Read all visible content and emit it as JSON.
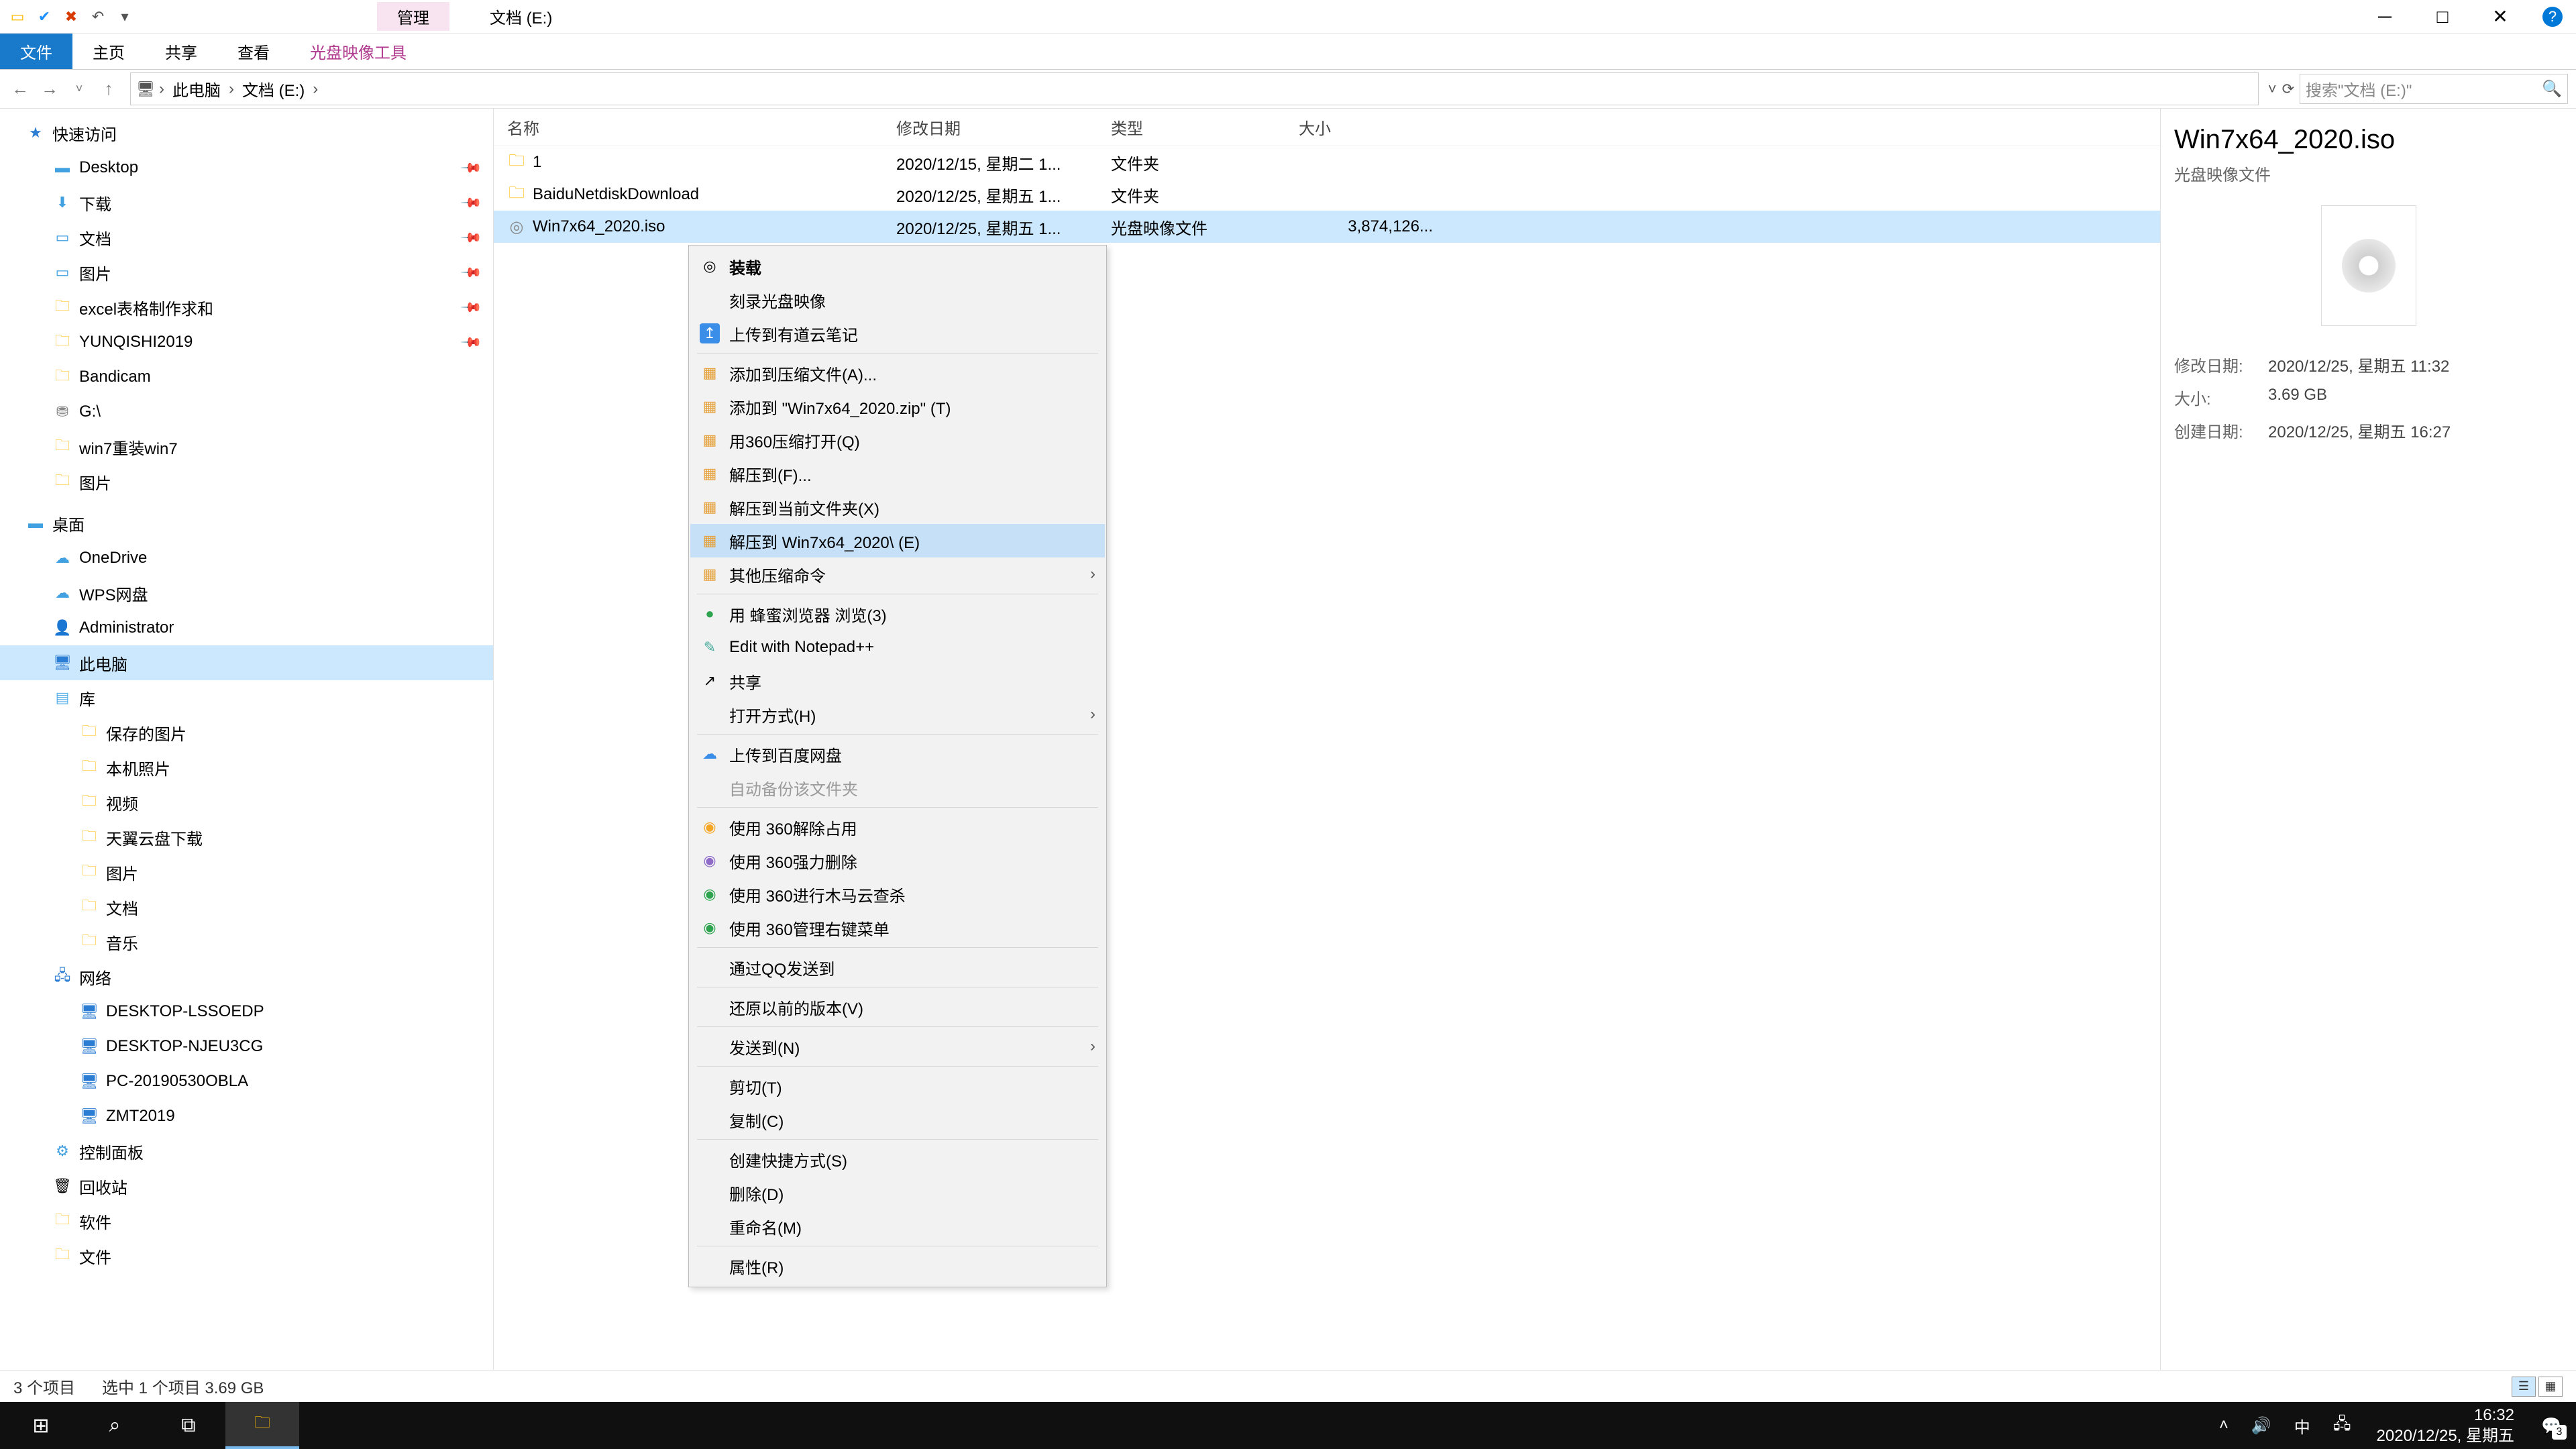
{
  "titlebar": {
    "ctx_tab": "管理",
    "title": "文档 (E:)"
  },
  "ribbon": {
    "file": "文件",
    "home": "主页",
    "share": "共享",
    "view": "查看",
    "ctx": "光盘映像工具"
  },
  "address": {
    "crumbs": [
      "此电脑",
      "文档 (E:)"
    ],
    "search_placeholder": "搜索\"文档 (E:)\""
  },
  "sidebar": {
    "quick": "快速访问",
    "desktop": "Desktop",
    "downloads": "下载",
    "documents": "文档",
    "pictures": "图片",
    "excel": "excel表格制作求和",
    "yunqishi": "YUNQISHI2019",
    "bandicam": "Bandicam",
    "gdrive": "G:\\",
    "win7reinstall": "win7重装win7",
    "pictures2": "图片",
    "desk_group": "桌面",
    "onedrive": "OneDrive",
    "wps": "WPS网盘",
    "admin": "Administrator",
    "thispc": "此电脑",
    "libraries": "库",
    "savedpics": "保存的图片",
    "localpics": "本机照片",
    "videos": "视频",
    "tianyi": "天翼云盘下载",
    "pics3": "图片",
    "docs2": "文档",
    "music": "音乐",
    "network": "网络",
    "n1": "DESKTOP-LSSOEDP",
    "n2": "DESKTOP-NJEU3CG",
    "n3": "PC-20190530OBLA",
    "n4": "ZMT2019",
    "cpanel": "控制面板",
    "recycle": "回收站",
    "software": "软件",
    "files": "文件"
  },
  "cols": {
    "name": "名称",
    "date": "修改日期",
    "type": "类型",
    "size": "大小"
  },
  "rows": [
    {
      "name": "1",
      "date": "2020/12/15, 星期二 1...",
      "type": "文件夹",
      "size": "",
      "icon": "folder"
    },
    {
      "name": "BaiduNetdiskDownload",
      "date": "2020/12/25, 星期五 1...",
      "type": "文件夹",
      "size": "",
      "icon": "folder"
    },
    {
      "name": "Win7x64_2020.iso",
      "date": "2020/12/25, 星期五 1...",
      "type": "光盘映像文件",
      "size": "3,874,126...",
      "icon": "iso",
      "selected": true
    }
  ],
  "details": {
    "title": "Win7x64_2020.iso",
    "subtitle": "光盘映像文件",
    "mod_label": "修改日期:",
    "mod_val": "2020/12/25, 星期五 11:32",
    "size_label": "大小:",
    "size_val": "3.69 GB",
    "created_label": "创建日期:",
    "created_val": "2020/12/25, 星期五 16:27"
  },
  "ctxmenu": {
    "mount": "装载",
    "burn": "刻录光盘映像",
    "youdao": "上传到有道云笔记",
    "addarchive": "添加到压缩文件(A)...",
    "addzip": "添加到 \"Win7x64_2020.zip\" (T)",
    "open360": "用360压缩打开(Q)",
    "extractto": "解压到(F)...",
    "extracthere": "解压到当前文件夹(X)",
    "extractfolder": "解压到 Win7x64_2020\\ (E)",
    "othercomp": "其他压缩命令",
    "honeybrowser": "用 蜂蜜浏览器 浏览(3)",
    "notepadpp": "Edit with Notepad++",
    "share": "共享",
    "openwith": "打开方式(H)",
    "baidupan": "上传到百度网盘",
    "autobackup": "自动备份该文件夹",
    "unlock360": "使用 360解除占用",
    "forcedel360": "使用 360强力删除",
    "trojan360": "使用 360进行木马云查杀",
    "manage360": "使用 360管理右键菜单",
    "qqsend": "通过QQ发送到",
    "restore": "还原以前的版本(V)",
    "sendto": "发送到(N)",
    "cut": "剪切(T)",
    "copy": "复制(C)",
    "shortcut": "创建快捷方式(S)",
    "delete": "删除(D)",
    "rename": "重命名(M)",
    "props": "属性(R)"
  },
  "status": {
    "count": "3 个项目",
    "sel": "选中 1 个项目  3.69 GB"
  },
  "taskbar": {
    "time": "16:32",
    "date": "2020/12/25, 星期五",
    "ime": "中",
    "notif_count": "3"
  }
}
